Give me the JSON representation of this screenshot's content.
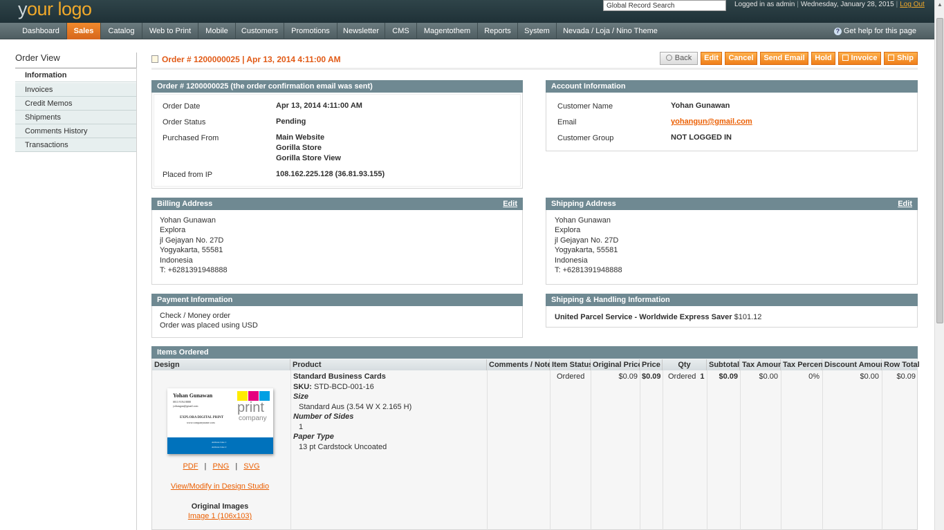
{
  "header": {
    "logo_prefix": "y",
    "logo_text": "our logo",
    "search_value": "Global Record Search",
    "logged_in": "Logged in as admin",
    "date": "Wednesday, January 28, 2015",
    "logout": "Log Out"
  },
  "nav": {
    "items": [
      "Dashboard",
      "Sales",
      "Catalog",
      "Web to Print",
      "Mobile",
      "Customers",
      "Promotions",
      "Newsletter",
      "CMS",
      "Magentothem",
      "Reports",
      "System",
      "Nevada / Loja / Nino Theme"
    ],
    "active": "Sales",
    "help": "Get help for this page"
  },
  "sidebar": {
    "title": "Order View",
    "items": [
      "Information",
      "Invoices",
      "Credit Memos",
      "Shipments",
      "Comments History",
      "Transactions"
    ]
  },
  "page": {
    "title": "Order # 1200000025 | Apr 13, 2014 4:11:00 AM",
    "buttons": [
      "Back",
      "Edit",
      "Cancel",
      "Send Email",
      "Hold",
      "Invoice",
      "Ship"
    ]
  },
  "order_box": {
    "title": "Order # 1200000025 (the order confirmation email was sent)",
    "order_date_label": "Order Date",
    "order_date": "Apr 13, 2014 4:11:00 AM",
    "status_label": "Order Status",
    "status": "Pending",
    "purchased_label": "Purchased From",
    "purchased_1": "Main Website",
    "purchased_2": "Gorilla Store",
    "purchased_3": "Gorilla Store View",
    "ip_label": "Placed from IP",
    "ip": "108.162.225.128 (36.81.93.155)"
  },
  "account_box": {
    "title": "Account Information",
    "name_label": "Customer Name",
    "name": "Yohan Gunawan",
    "email_label": "Email",
    "email": "yohangun@gmail.com",
    "group_label": "Customer Group",
    "group": "NOT LOGGED IN"
  },
  "billing": {
    "title": "Billing Address",
    "edit": "Edit",
    "lines": [
      "Yohan Gunawan",
      "Explora",
      "jl Gejayan No. 27D",
      "Yogyakarta, 55581",
      "Indonesia",
      "T: +6281391948888"
    ]
  },
  "shipping": {
    "title": "Shipping Address",
    "edit": "Edit",
    "lines": [
      "Yohan Gunawan",
      "Explora",
      "jl Gejayan No. 27D",
      "Yogyakarta, 55581",
      "Indonesia",
      "T: +6281391948888"
    ]
  },
  "payment": {
    "title": "Payment Information",
    "method": "Check / Money order",
    "currency": "Order was placed using USD"
  },
  "shipping_handling": {
    "title": "Shipping & Handling Information",
    "method": "United Parcel Service - Worldwide Express Saver",
    "price": "$101.12"
  },
  "items": {
    "title": "Items Ordered",
    "columns": [
      "Design",
      "Product",
      "Comments / Notes",
      "Item Status",
      "Original Price",
      "Price",
      "Qty",
      "Subtotal",
      "Tax Amount",
      "Tax Percent",
      "Discount Amount",
      "Row Total"
    ],
    "row": {
      "product_name": "Standard Business Cards",
      "sku_label": "SKU:",
      "sku": "STD-BCD-001-16",
      "opt1_label": "Size",
      "opt1_value": "Standard Aus (3.54 W X 2.165 H)",
      "opt2_label": "Number of Sides",
      "opt2_value": "1",
      "opt3_label": "Paper Type",
      "opt3_value": "13 pt Cardstock Uncoated",
      "status": "Ordered",
      "original_price": "$0.09",
      "price": "$0.09",
      "qty_label": "Ordered",
      "qty": "1",
      "subtotal": "$0.09",
      "tax_amount": "$0.00",
      "tax_percent": "0%",
      "discount": "$0.00",
      "row_total": "$0.09"
    },
    "design": {
      "card_name": "Yohan Gunawan",
      "card_phone": "0813 9194 8888",
      "card_email": "yohangun@gmail.com",
      "card_company": "EXPLORA DIGITAL PRINT",
      "card_url": "www.companyname.com",
      "card_print": "print",
      "card_company_word": "company",
      "card_addr1": "Address Line 1",
      "card_addr2": "Address Line 2",
      "link_pdf": "PDF",
      "link_png": "PNG",
      "link_svg": "SVG",
      "separator": "|",
      "modify": "View/Modify in Design Studio",
      "original_images": "Original Images",
      "image1": "Image 1 (106x103)"
    }
  },
  "colors": {
    "accent": "#eb5e00",
    "box_header": "#6f8992",
    "nav_active": "#e2711f"
  }
}
